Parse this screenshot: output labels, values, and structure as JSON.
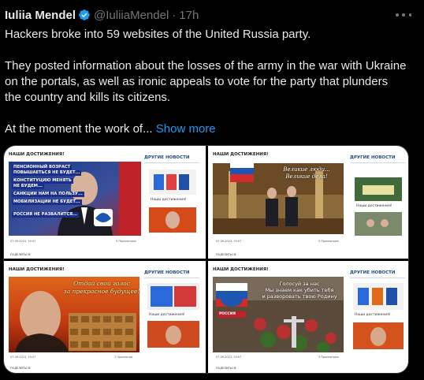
{
  "author": {
    "name": "Iuliia Mendel",
    "handle": "@IuliiaMendel",
    "separator": "·",
    "time": "17h"
  },
  "icons": {
    "verified": "verified-badge-icon",
    "more": "more-options-icon"
  },
  "colors": {
    "background": "#000000",
    "text": "#e7e9ea",
    "muted": "#71767b",
    "link": "#1d9bf0",
    "verified": "#1d9bf0"
  },
  "tweet": {
    "line1": "Hackers broke into 59 websites of the United Russia party.",
    "line2": "They posted information about the losses of the army in the war with Ukraine on the portals, as well as ironic appeals to vote for the party that plunders the country and kills its citizens.",
    "line3": "At the moment the work of...",
    "show_more": "Show more"
  },
  "media": {
    "panels": [
      {
        "heading": "НАШИ ДОСТИЖЕНИЯ!",
        "side_title": "ДРУГИЕ НОВОСТИ",
        "slogans": [
          "ПЕНСИОННЫЙ ВОЗРАСТ",
          "ПОВЫШАЕТЬСЯ НЕ БУДЕТ...",
          "КОНСТИТУЦИЮ МЕНЯТЬ",
          "НЕ БУДЕМ...",
          "САНКЦИИ НАМ НА ПОЛЬЗУ...",
          "МОБИЛИЗАЦИИ НЕ БУДЕТ...",
          "РОССИЯ НЕ РАЗВАЛИТСЯ..."
        ],
        "date": "07.09.2023, 19:07",
        "views": "5 Просмотров",
        "share": "ПОДЕЛИТЬСЯ:",
        "side_caption": "Наши достижения!"
      },
      {
        "heading": "НАШИ ДОСТИЖЕНИЯ!",
        "side_title": "ДРУГИЕ НОВОСТИ",
        "overlay_line1": "Великие люди...",
        "overlay_line2": "Великие дела!",
        "date": "07.09.2023, 19:07",
        "views": "5 Просмотров",
        "share": "ПОДЕЛИТЬСЯ:",
        "side_caption": "Наши достижения!"
      },
      {
        "heading": "НАШИ ДОСТИЖЕНИЯ!",
        "side_title": "ДРУГИЕ НОВОСТИ",
        "overlay_line1": "Отдай свой голос",
        "overlay_line2": "за прекрасное будущее!",
        "date": "07.09.2023, 19:07",
        "views": "2 Просмотра",
        "share": "ПОДЕЛИТЬСЯ:",
        "side_caption": "Наши достижения!"
      },
      {
        "heading": "НАШИ ДОСТИЖЕНИЯ!",
        "side_title": "ДРУГИЕ НОВОСТИ",
        "overlay_line1": "Голосуй за нас",
        "overlay_line2": "Мы знаем как убить тебя",
        "overlay_line3": "и разворовать твою Родину",
        "badge": "РОССИЯ",
        "date": "07.09.2023, 19:07",
        "views": "5 Просмотров",
        "share": "ПОДЕЛИТЬСЯ:",
        "side_caption": "Наши достижения!"
      }
    ]
  }
}
